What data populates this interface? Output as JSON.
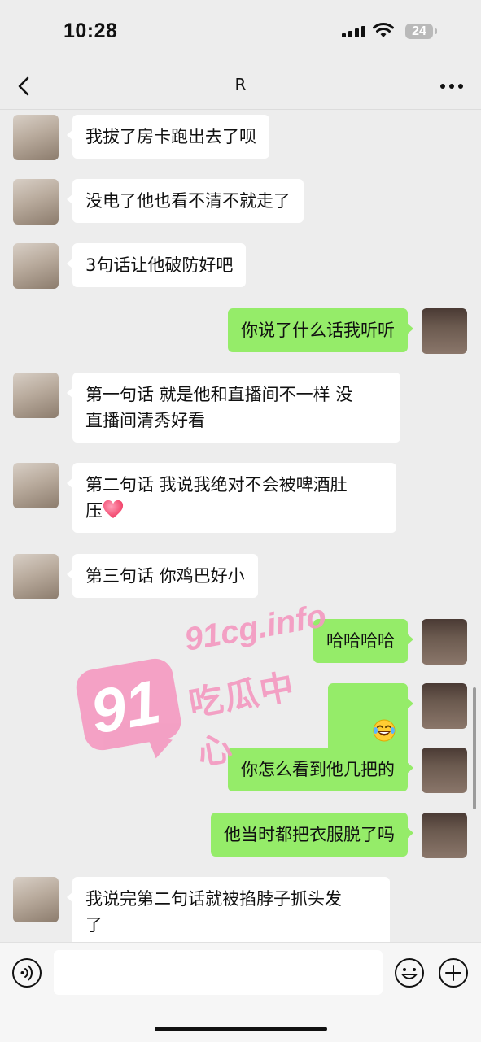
{
  "status_bar": {
    "time": "10:28",
    "battery_level": "24"
  },
  "header": {
    "title": "R"
  },
  "messages": [
    {
      "side": "left",
      "text": "我拔了房卡跑出去了呗"
    },
    {
      "side": "left",
      "text": "没电了他也看不清不就走了"
    },
    {
      "side": "left",
      "text": "3句话让他破防好吧"
    },
    {
      "side": "right",
      "text": "你说了什么话我听听"
    },
    {
      "side": "left",
      "text": "第一句话 就是他和直播间不一样 没\n直播间清秀好看"
    },
    {
      "side": "left",
      "text": "第二句话 我说我绝对不会被啤酒肚\n压",
      "trailing_icon": "heart"
    },
    {
      "side": "left",
      "text": "第三句话 你鸡巴好小"
    },
    {
      "side": "right",
      "text": "哈哈哈哈"
    },
    {
      "side": "right",
      "text": "",
      "emoji": "laughing-with-tears"
    },
    {
      "side": "right",
      "text": "你怎么看到他几把的"
    },
    {
      "side": "right",
      "text": "他当时都把衣服脱了吗"
    },
    {
      "side": "left",
      "text": "我说完第二句话就被掐脖子抓头发\n了"
    }
  ],
  "watermark": {
    "number": "91",
    "domain": "91cg.info",
    "chinese": "吃瓜中心",
    "color": "#f49ac1"
  },
  "input": {
    "placeholder": ""
  },
  "colors": {
    "background": "#ededed",
    "bubble_incoming": "#ffffff",
    "bubble_outgoing": "#95ec69"
  }
}
